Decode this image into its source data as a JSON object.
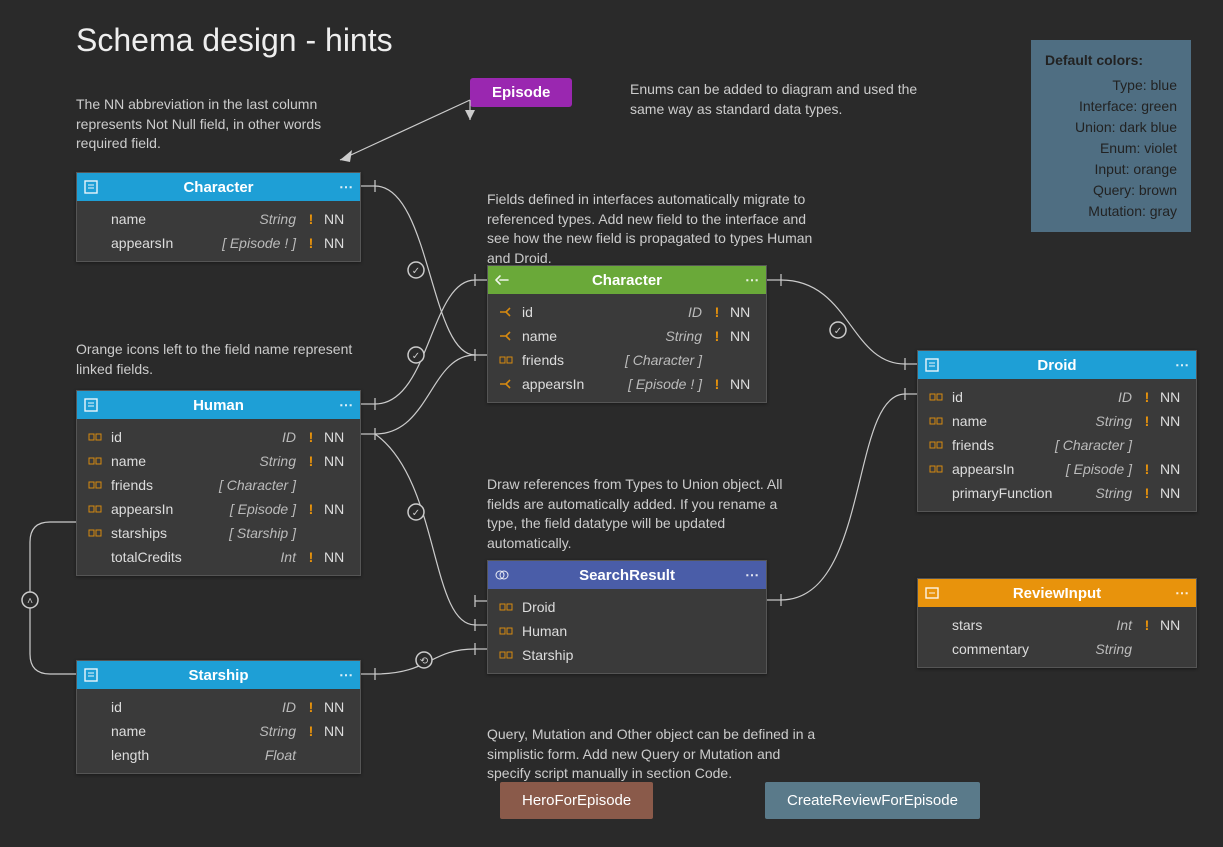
{
  "title": "Schema design - hints",
  "hints": {
    "nn": "The NN abbreviation in the last column represents Not Null field, in other words required field.",
    "enum": "Enums can be added to diagram and used the same way as standard data types.",
    "interface": "Fields defined in interfaces automatically migrate to referenced types. Add new field to the interface and see how the new field is propagated to types Human and Droid.",
    "linked": "Orange icons left to the field name represent linked fields.",
    "union": "Draw references from Types to Union object. All fields are automatically added. If you rename a type, the field datatype will be updated automatically.",
    "query": "Query, Mutation and Other object can be defined in a simplistic form. Add new Query or Mutation and specify script manually in section Code."
  },
  "enum": {
    "label": "Episode"
  },
  "legend": {
    "title": "Default colors:",
    "rows": {
      "type": "Type: blue",
      "interface": "Interface: green",
      "union": "Union: dark blue",
      "enum": "Enum: violet",
      "input": "Input: orange",
      "query": "Query: brown",
      "mutation": "Mutation: gray"
    }
  },
  "entities": {
    "character1": {
      "title": "Character",
      "fields": {
        "name": {
          "name": "name",
          "type": "String",
          "excl": "!",
          "nn": "NN"
        },
        "appearsIn": {
          "name": "appearsIn",
          "type": "[ Episode ! ]",
          "excl": "!",
          "nn": "NN"
        }
      }
    },
    "character2": {
      "title": "Character",
      "fields": {
        "id": {
          "name": "id",
          "type": "ID",
          "excl": "!",
          "nn": "NN"
        },
        "name": {
          "name": "name",
          "type": "String",
          "excl": "!",
          "nn": "NN"
        },
        "friends": {
          "name": "friends",
          "type": "[ Character ]",
          "excl": "",
          "nn": ""
        },
        "appearsIn": {
          "name": "appearsIn",
          "type": "[ Episode ! ]",
          "excl": "!",
          "nn": "NN"
        }
      }
    },
    "human": {
      "title": "Human",
      "fields": {
        "id": {
          "name": "id",
          "type": "ID",
          "excl": "!",
          "nn": "NN"
        },
        "name": {
          "name": "name",
          "type": "String",
          "excl": "!",
          "nn": "NN"
        },
        "friends": {
          "name": "friends",
          "type": "[ Character ]",
          "excl": "",
          "nn": ""
        },
        "appearsIn": {
          "name": "appearsIn",
          "type": "[ Episode ]",
          "excl": "!",
          "nn": "NN"
        },
        "starships": {
          "name": "starships",
          "type": "[ Starship ]",
          "excl": "",
          "nn": ""
        },
        "totalCredits": {
          "name": "totalCredits",
          "type": "Int",
          "excl": "!",
          "nn": "NN"
        }
      }
    },
    "droid": {
      "title": "Droid",
      "fields": {
        "id": {
          "name": "id",
          "type": "ID",
          "excl": "!",
          "nn": "NN"
        },
        "name": {
          "name": "name",
          "type": "String",
          "excl": "!",
          "nn": "NN"
        },
        "friends": {
          "name": "friends",
          "type": "[ Character ]",
          "excl": "",
          "nn": ""
        },
        "appearsIn": {
          "name": "appearsIn",
          "type": "[ Episode ]",
          "excl": "!",
          "nn": "NN"
        },
        "primaryFunction": {
          "name": "primaryFunction",
          "type": "String",
          "excl": "!",
          "nn": "NN"
        }
      }
    },
    "starship": {
      "title": "Starship",
      "fields": {
        "id": {
          "name": "id",
          "type": "ID",
          "excl": "!",
          "nn": "NN"
        },
        "name": {
          "name": "name",
          "type": "String",
          "excl": "!",
          "nn": "NN"
        },
        "length": {
          "name": "length",
          "type": "Float",
          "excl": "",
          "nn": ""
        }
      }
    },
    "searchResult": {
      "title": "SearchResult",
      "fields": {
        "droid": {
          "name": "Droid"
        },
        "human": {
          "name": "Human"
        },
        "starship": {
          "name": "Starship"
        }
      }
    },
    "reviewInput": {
      "title": "ReviewInput",
      "fields": {
        "stars": {
          "name": "stars",
          "type": "Int",
          "excl": "!",
          "nn": "NN"
        },
        "commentary": {
          "name": "commentary",
          "type": "String",
          "excl": "",
          "nn": ""
        }
      }
    }
  },
  "buttons": {
    "hero": "HeroForEpisode",
    "create": "CreateReviewForEpisode"
  }
}
